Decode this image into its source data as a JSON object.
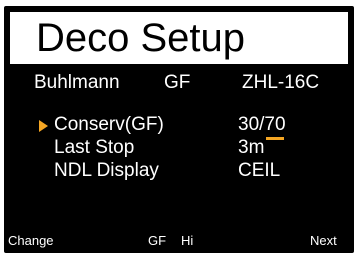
{
  "title": "Deco Setup",
  "header": {
    "model": "Buhlmann",
    "gf": "GF",
    "algorithm": "ZHL-16C"
  },
  "rows": [
    {
      "label": "Conserv(GF)",
      "value_low": "30",
      "value_sep": "/",
      "value_high": "70",
      "selected": true
    },
    {
      "label": "Last Stop",
      "value": "3m"
    },
    {
      "label": "NDL Display",
      "value": "CEIL"
    }
  ],
  "footer": {
    "left": "Change",
    "mid_gf": "GF",
    "mid_hi": "Hi",
    "right": "Next"
  },
  "colors": {
    "background": "#000000",
    "text": "#ffffff",
    "accent": "#f5a623",
    "title_bar": "#ffffff"
  },
  "icons": {
    "cursor": "selection-arrow-icon"
  }
}
